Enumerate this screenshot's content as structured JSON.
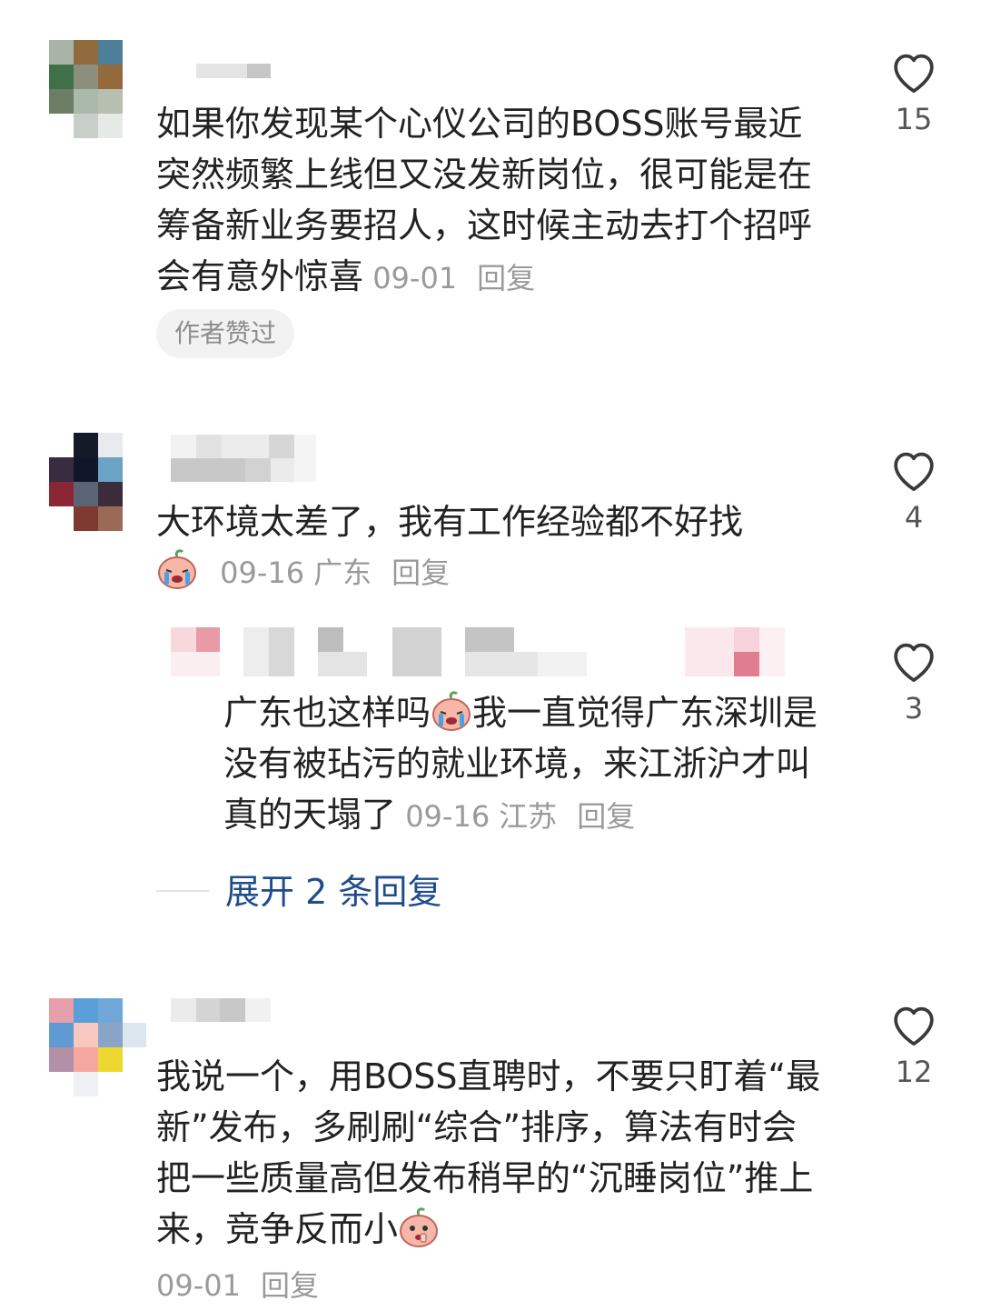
{
  "comments": [
    {
      "text": "如果你发现某个心仪公司的BOSS账号最近突然频繁上线但又没发新岗位，很可能是在筹备新业务要招人，这时候主动去打个招呼会有意外惊喜",
      "date": "09-01",
      "reply_label": "回复",
      "badge": "作者赞过",
      "likes": "15"
    },
    {
      "text": "大环境太差了，我有工作经验都不好找",
      "date": "09-16",
      "location": "广东",
      "reply_label": "回复",
      "likes": "4",
      "emoji": "crying-emoji"
    },
    {
      "text_before": "广东也这样吗",
      "text_after": "我一直觉得广东深圳是没有被玷污的就业环境，来江浙沪才叫真的天塌了",
      "date": "09-16",
      "location": "江苏",
      "reply_label": "回复",
      "likes": "3",
      "emoji": "crying-emoji"
    },
    {
      "text": "我说一个，用BOSS直聘时，不要只盯着“最新”发布，多刷刷“综合”排序，算法有时会把一些质量高但发布稍早的“沉睡岗位”推上来，竞争反而小",
      "date": "09-01",
      "reply_label": "回复",
      "likes": "12",
      "emoji": "pointing-emoji"
    }
  ],
  "expand_label": "展开 2 条回复",
  "icons": {
    "like": "heart-outline-icon"
  },
  "colors": {
    "text": "#222222",
    "meta": "#9a9a9a",
    "link": "#1f4d8c",
    "badge_bg": "#f2f2f2"
  }
}
